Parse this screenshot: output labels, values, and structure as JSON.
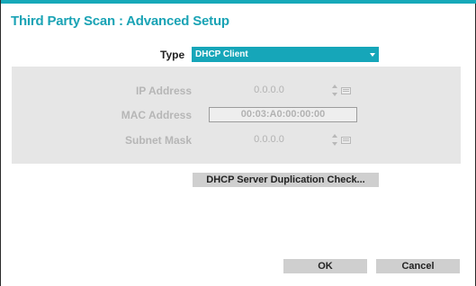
{
  "dialog": {
    "title": "Third Party Scan : Advanced Setup"
  },
  "type": {
    "label": "Type",
    "value": "DHCP Client",
    "icon": "chevron-down-icon"
  },
  "network": {
    "ip_address": {
      "label": "IP Address",
      "value": "0.0.0.0"
    },
    "mac_address": {
      "label": "MAC Address",
      "value": "00:03:A0:00:00:00"
    },
    "subnet_mask": {
      "label": "Subnet Mask",
      "value": "0.0.0.0"
    }
  },
  "buttons": {
    "dhcp_check": "DHCP Server Duplication Check...",
    "ok": "OK",
    "cancel": "Cancel"
  },
  "colors": {
    "accent": "#17a9b9",
    "panel": "#e6e6e6",
    "button": "#cfcfcf",
    "disabled_text": "#b6b6b6"
  }
}
